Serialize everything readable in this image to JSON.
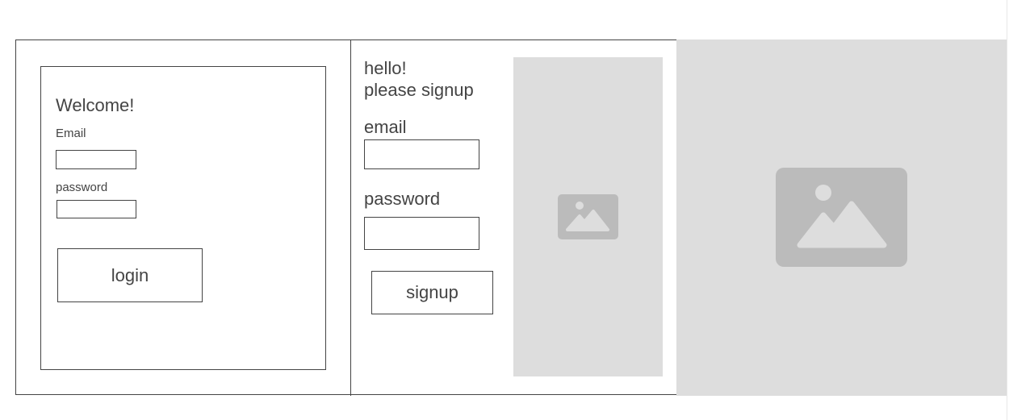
{
  "login": {
    "title": "Welcome!",
    "email_label": "Email",
    "email_value": "",
    "password_label": "password",
    "password_value": "",
    "button_label": "login"
  },
  "signup": {
    "greeting_line1": "hello!",
    "greeting_line2": "please signup",
    "email_label": "email",
    "email_value": "",
    "password_label": "password",
    "password_value": "",
    "button_label": "signup"
  },
  "images": {
    "small_icon": "image-icon",
    "large_icon": "image-icon"
  },
  "colors": {
    "stroke": "#444444",
    "placeholder_bg": "#dddddd",
    "placeholder_icon": "#bbbbbb",
    "background": "#ffffff"
  }
}
